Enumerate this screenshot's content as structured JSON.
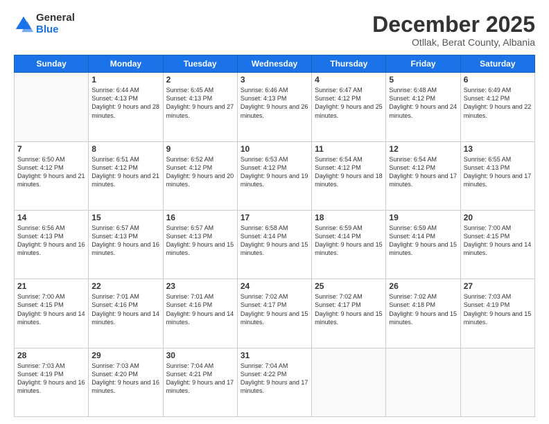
{
  "logo": {
    "general": "General",
    "blue": "Blue"
  },
  "header": {
    "month": "December 2025",
    "location": "Otllak, Berat County, Albania"
  },
  "weekdays": [
    "Sunday",
    "Monday",
    "Tuesday",
    "Wednesday",
    "Thursday",
    "Friday",
    "Saturday"
  ],
  "weeks": [
    [
      {
        "day": "",
        "sunrise": "",
        "sunset": "",
        "daylight": ""
      },
      {
        "day": "1",
        "sunrise": "Sunrise: 6:44 AM",
        "sunset": "Sunset: 4:13 PM",
        "daylight": "Daylight: 9 hours and 28 minutes."
      },
      {
        "day": "2",
        "sunrise": "Sunrise: 6:45 AM",
        "sunset": "Sunset: 4:13 PM",
        "daylight": "Daylight: 9 hours and 27 minutes."
      },
      {
        "day": "3",
        "sunrise": "Sunrise: 6:46 AM",
        "sunset": "Sunset: 4:13 PM",
        "daylight": "Daylight: 9 hours and 26 minutes."
      },
      {
        "day": "4",
        "sunrise": "Sunrise: 6:47 AM",
        "sunset": "Sunset: 4:12 PM",
        "daylight": "Daylight: 9 hours and 25 minutes."
      },
      {
        "day": "5",
        "sunrise": "Sunrise: 6:48 AM",
        "sunset": "Sunset: 4:12 PM",
        "daylight": "Daylight: 9 hours and 24 minutes."
      },
      {
        "day": "6",
        "sunrise": "Sunrise: 6:49 AM",
        "sunset": "Sunset: 4:12 PM",
        "daylight": "Daylight: 9 hours and 22 minutes."
      }
    ],
    [
      {
        "day": "7",
        "sunrise": "Sunrise: 6:50 AM",
        "sunset": "Sunset: 4:12 PM",
        "daylight": "Daylight: 9 hours and 21 minutes."
      },
      {
        "day": "8",
        "sunrise": "Sunrise: 6:51 AM",
        "sunset": "Sunset: 4:12 PM",
        "daylight": "Daylight: 9 hours and 21 minutes."
      },
      {
        "day": "9",
        "sunrise": "Sunrise: 6:52 AM",
        "sunset": "Sunset: 4:12 PM",
        "daylight": "Daylight: 9 hours and 20 minutes."
      },
      {
        "day": "10",
        "sunrise": "Sunrise: 6:53 AM",
        "sunset": "Sunset: 4:12 PM",
        "daylight": "Daylight: 9 hours and 19 minutes."
      },
      {
        "day": "11",
        "sunrise": "Sunrise: 6:54 AM",
        "sunset": "Sunset: 4:12 PM",
        "daylight": "Daylight: 9 hours and 18 minutes."
      },
      {
        "day": "12",
        "sunrise": "Sunrise: 6:54 AM",
        "sunset": "Sunset: 4:12 PM",
        "daylight": "Daylight: 9 hours and 17 minutes."
      },
      {
        "day": "13",
        "sunrise": "Sunrise: 6:55 AM",
        "sunset": "Sunset: 4:13 PM",
        "daylight": "Daylight: 9 hours and 17 minutes."
      }
    ],
    [
      {
        "day": "14",
        "sunrise": "Sunrise: 6:56 AM",
        "sunset": "Sunset: 4:13 PM",
        "daylight": "Daylight: 9 hours and 16 minutes."
      },
      {
        "day": "15",
        "sunrise": "Sunrise: 6:57 AM",
        "sunset": "Sunset: 4:13 PM",
        "daylight": "Daylight: 9 hours and 16 minutes."
      },
      {
        "day": "16",
        "sunrise": "Sunrise: 6:57 AM",
        "sunset": "Sunset: 4:13 PM",
        "daylight": "Daylight: 9 hours and 15 minutes."
      },
      {
        "day": "17",
        "sunrise": "Sunrise: 6:58 AM",
        "sunset": "Sunset: 4:14 PM",
        "daylight": "Daylight: 9 hours and 15 minutes."
      },
      {
        "day": "18",
        "sunrise": "Sunrise: 6:59 AM",
        "sunset": "Sunset: 4:14 PM",
        "daylight": "Daylight: 9 hours and 15 minutes."
      },
      {
        "day": "19",
        "sunrise": "Sunrise: 6:59 AM",
        "sunset": "Sunset: 4:14 PM",
        "daylight": "Daylight: 9 hours and 15 minutes."
      },
      {
        "day": "20",
        "sunrise": "Sunrise: 7:00 AM",
        "sunset": "Sunset: 4:15 PM",
        "daylight": "Daylight: 9 hours and 14 minutes."
      }
    ],
    [
      {
        "day": "21",
        "sunrise": "Sunrise: 7:00 AM",
        "sunset": "Sunset: 4:15 PM",
        "daylight": "Daylight: 9 hours and 14 minutes."
      },
      {
        "day": "22",
        "sunrise": "Sunrise: 7:01 AM",
        "sunset": "Sunset: 4:16 PM",
        "daylight": "Daylight: 9 hours and 14 minutes."
      },
      {
        "day": "23",
        "sunrise": "Sunrise: 7:01 AM",
        "sunset": "Sunset: 4:16 PM",
        "daylight": "Daylight: 9 hours and 14 minutes."
      },
      {
        "day": "24",
        "sunrise": "Sunrise: 7:02 AM",
        "sunset": "Sunset: 4:17 PM",
        "daylight": "Daylight: 9 hours and 15 minutes."
      },
      {
        "day": "25",
        "sunrise": "Sunrise: 7:02 AM",
        "sunset": "Sunset: 4:17 PM",
        "daylight": "Daylight: 9 hours and 15 minutes."
      },
      {
        "day": "26",
        "sunrise": "Sunrise: 7:02 AM",
        "sunset": "Sunset: 4:18 PM",
        "daylight": "Daylight: 9 hours and 15 minutes."
      },
      {
        "day": "27",
        "sunrise": "Sunrise: 7:03 AM",
        "sunset": "Sunset: 4:19 PM",
        "daylight": "Daylight: 9 hours and 15 minutes."
      }
    ],
    [
      {
        "day": "28",
        "sunrise": "Sunrise: 7:03 AM",
        "sunset": "Sunset: 4:19 PM",
        "daylight": "Daylight: 9 hours and 16 minutes."
      },
      {
        "day": "29",
        "sunrise": "Sunrise: 7:03 AM",
        "sunset": "Sunset: 4:20 PM",
        "daylight": "Daylight: 9 hours and 16 minutes."
      },
      {
        "day": "30",
        "sunrise": "Sunrise: 7:04 AM",
        "sunset": "Sunset: 4:21 PM",
        "daylight": "Daylight: 9 hours and 17 minutes."
      },
      {
        "day": "31",
        "sunrise": "Sunrise: 7:04 AM",
        "sunset": "Sunset: 4:22 PM",
        "daylight": "Daylight: 9 hours and 17 minutes."
      },
      {
        "day": "",
        "sunrise": "",
        "sunset": "",
        "daylight": ""
      },
      {
        "day": "",
        "sunrise": "",
        "sunset": "",
        "daylight": ""
      },
      {
        "day": "",
        "sunrise": "",
        "sunset": "",
        "daylight": ""
      }
    ]
  ]
}
